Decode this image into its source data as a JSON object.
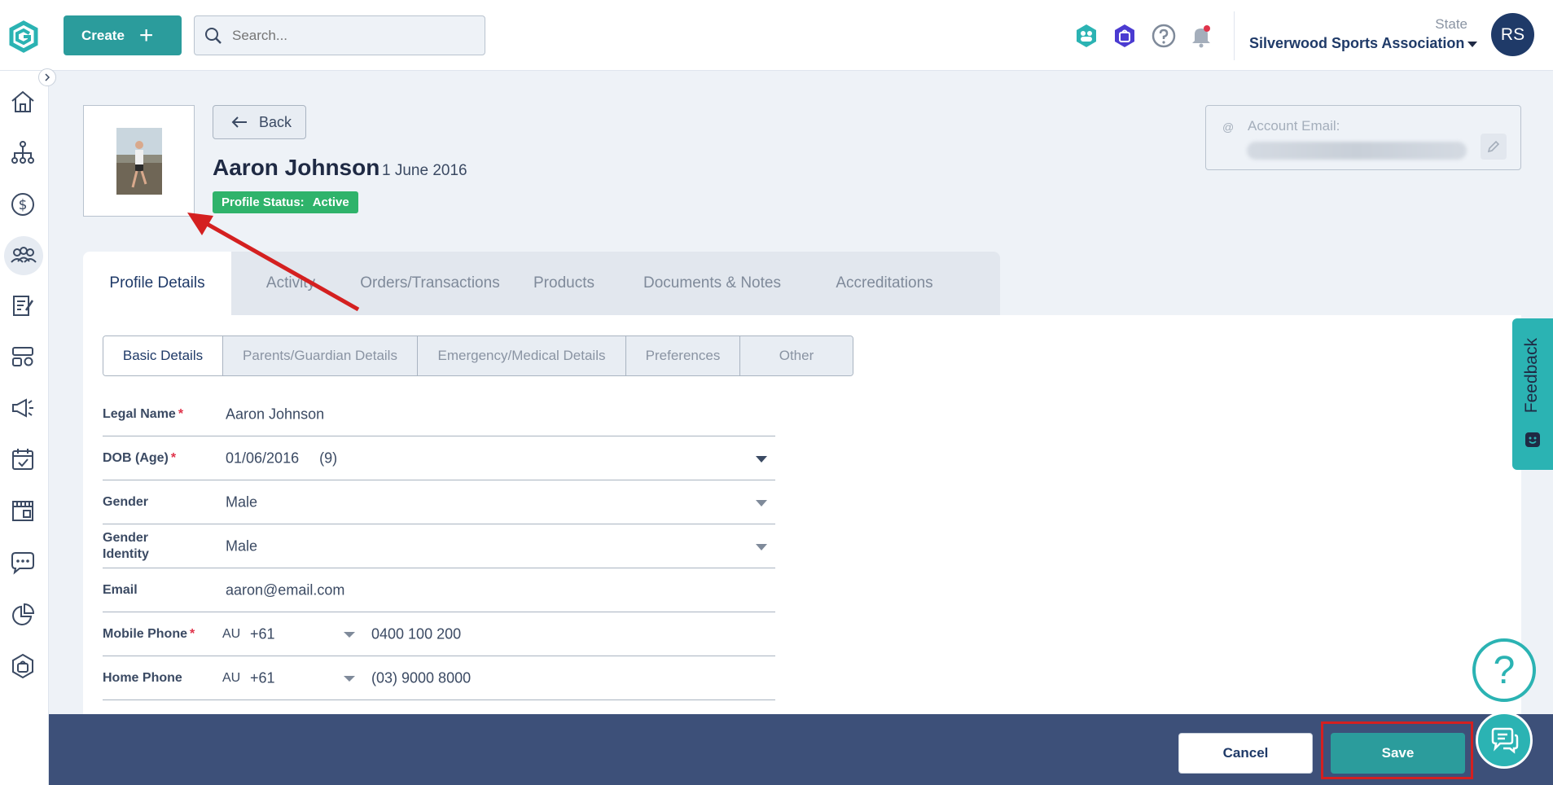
{
  "header": {
    "create_label": "Create",
    "search_placeholder": "Search...",
    "org_label": "State",
    "org_name": "Silverwood Sports Association",
    "avatar_initials": "RS"
  },
  "profile": {
    "back_label": "Back",
    "name": "Aaron Johnson",
    "dob_display": "1 June 2016",
    "status_label": "Profile Status:",
    "status_value": "Active",
    "account_email_label": "Account Email:",
    "account_email_prefix": "@"
  },
  "tabs": [
    {
      "label": "Profile Details",
      "active": true
    },
    {
      "label": "Activity"
    },
    {
      "label": "Orders/Transactions"
    },
    {
      "label": "Products"
    },
    {
      "label": "Documents & Notes"
    },
    {
      "label": "Accreditations"
    }
  ],
  "subtabs": [
    {
      "label": "Basic Details",
      "active": true
    },
    {
      "label": "Parents/Guardian Details"
    },
    {
      "label": "Emergency/Medical Details"
    },
    {
      "label": "Preferences"
    },
    {
      "label": "Other"
    }
  ],
  "form": {
    "legal_name": {
      "label": "Legal Name",
      "required_mark": "*",
      "value": "Aaron Johnson"
    },
    "dob": {
      "label": "DOB (Age)",
      "required_mark": "*",
      "value": "01/06/2016",
      "age": "(9)"
    },
    "gender": {
      "label": "Gender",
      "value": "Male"
    },
    "gender_identity": {
      "label": "Gender Identity",
      "value": "Male"
    },
    "email": {
      "label": "Email",
      "value": "aaron@email.com"
    },
    "mobile_phone": {
      "label": "Mobile Phone",
      "required_mark": "*",
      "country": "AU",
      "code": "+61",
      "value": "0400 100 200"
    },
    "home_phone": {
      "label": "Home Phone",
      "country": "AU",
      "code": "+61",
      "value": "(03) 9000 8000"
    }
  },
  "footer": {
    "cancel_label": "Cancel",
    "save_label": "Save"
  },
  "floating": {
    "feedback_label": "Feedback",
    "help_glyph": "?"
  },
  "colors": {
    "primary_teal": "#2b9c9c",
    "navy": "#1f3a68",
    "footer_bg": "#3d5079",
    "status_green": "#2fb36b",
    "annotation_red": "#d42020"
  }
}
